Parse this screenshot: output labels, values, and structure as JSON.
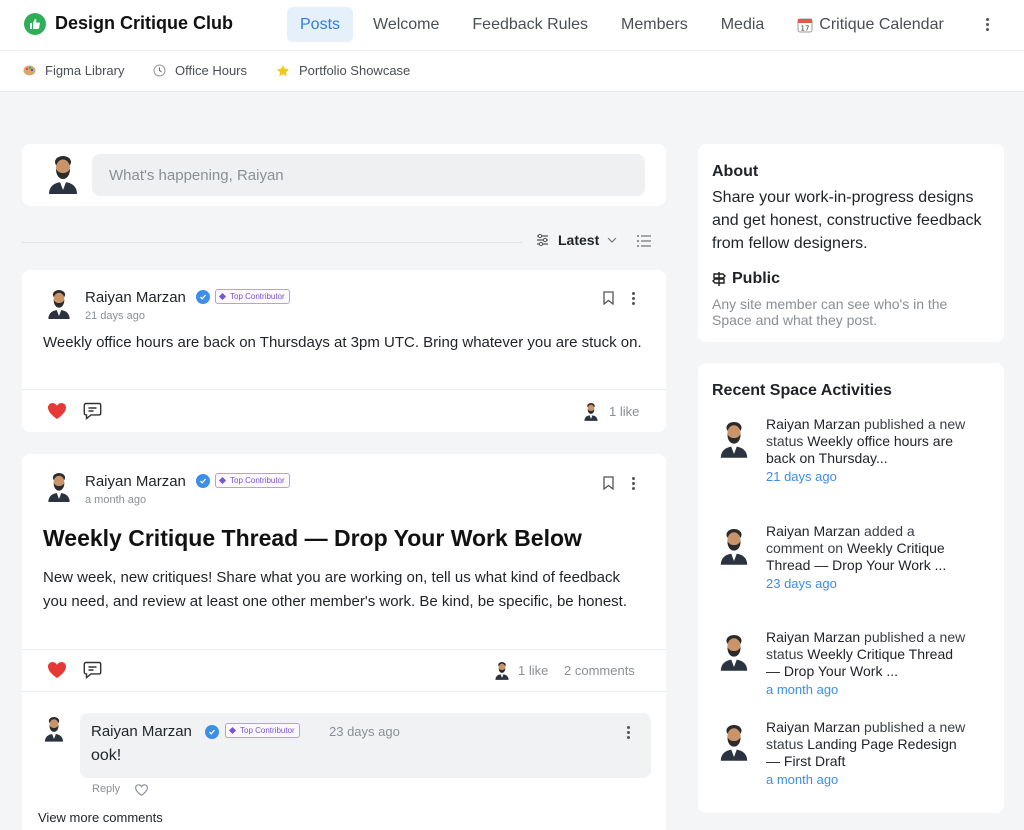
{
  "header": {
    "site_title": "Design Critique Club",
    "tabs": [
      "Posts",
      "Welcome",
      "Feedback Rules",
      "Members",
      "Media",
      "Critique Calendar"
    ],
    "calendar_icon": "calendar-icon"
  },
  "subnav": {
    "links": [
      "Figma Library",
      "Office Hours",
      "Portfolio Showcase"
    ]
  },
  "composer": {
    "placeholder": "What's happening, Raiyan"
  },
  "sort": {
    "label": "Latest"
  },
  "posts": [
    {
      "author": "Raiyan Marzan",
      "badge": "Top Contributor",
      "time": "21 days ago",
      "body": "Weekly office hours are back on Thursdays at 3pm UTC. Bring whatever you are stuck on.",
      "likes": "1 like"
    },
    {
      "author": "Raiyan Marzan",
      "badge": "Top Contributor",
      "time": "a month ago",
      "title": "Weekly Critique Thread — Drop Your Work Below",
      "body": "New week, new critiques! Share what you are working on, tell us what kind of feedback you need, and review at least one other member's work. Be kind, be specific, be honest.",
      "likes": "1 like",
      "comments": "2 comments",
      "comment": {
        "author": "Raiyan Marzan",
        "badge": "Top Contributor",
        "time": "23 days ago",
        "text": "ook!",
        "reply": "Reply"
      },
      "view_more": "View more comments"
    }
  ],
  "about": {
    "title": "About",
    "description": "Share your work-in-progress designs and get honest, constructive feedback from fellow designers.",
    "public_title": "Public",
    "public_desc": "Any site member can see who's in the Space and what they post."
  },
  "activities": {
    "title": "Recent Space Activities",
    "items": [
      {
        "actor": "Raiyan Marzan",
        "action": " published a new status ",
        "target": "Weekly office hours are back on Thursday...",
        "time": "21 days ago"
      },
      {
        "actor": "Raiyan Marzan",
        "action": " added a comment on ",
        "target": "Weekly Critique Thread — Drop Your Work ...",
        "time": "23 days ago"
      },
      {
        "actor": "Raiyan Marzan",
        "action": " published a new status ",
        "target": "Weekly Critique Thread — Drop Your Work ...",
        "time": "a month ago"
      },
      {
        "actor": "Raiyan Marzan",
        "action": " published a new status ",
        "target": "Landing Page Redesign — First Draft",
        "time": "a month ago"
      }
    ]
  },
  "colors": {
    "accent": "#2f7fd6",
    "brand_green": "#2eae57",
    "like_red": "#e53935",
    "badge_purple": "#7a52d8"
  }
}
